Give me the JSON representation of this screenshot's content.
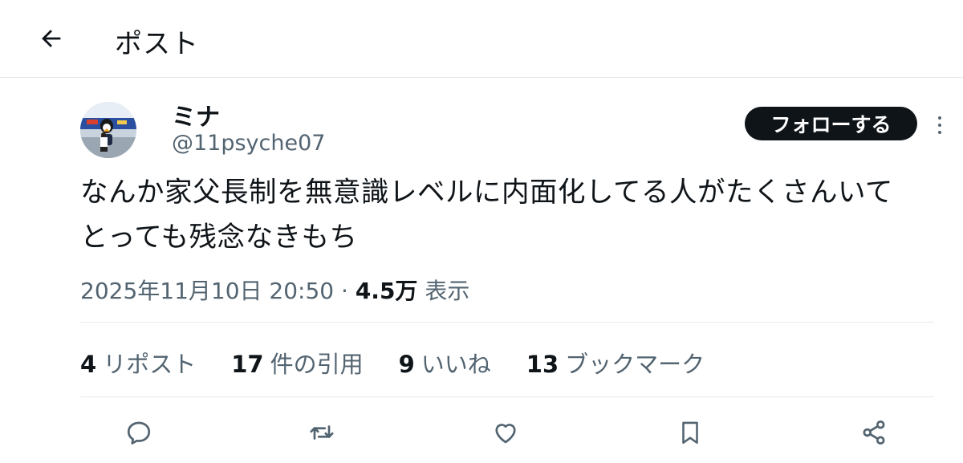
{
  "header": {
    "title": "ポスト",
    "back_icon": "arrow-left-icon"
  },
  "author": {
    "name": "ミナ",
    "handle": "@11psyche07",
    "follow_label": "フォローする"
  },
  "post": {
    "text": "なんか家父長制を無意識レベルに内面化してる人がたくさんいてとっても残念なきもち",
    "timestamp": "2025年11月10日 20:50",
    "separator": "·",
    "views_count": "4.5万",
    "views_label": "表示"
  },
  "stats": {
    "reposts": {
      "count": "4",
      "label": "リポスト"
    },
    "quotes": {
      "count": "17",
      "label": "件の引用"
    },
    "likes": {
      "count": "9",
      "label": "いいね"
    },
    "bookmarks": {
      "count": "13",
      "label": "ブックマーク"
    }
  },
  "actions": [
    "reply-icon",
    "repost-icon",
    "like-icon",
    "bookmark-icon",
    "share-icon"
  ],
  "colors": {
    "text": "#0f1419",
    "secondary": "#536471",
    "border": "#e6e9eb",
    "button": "#0f1419"
  }
}
